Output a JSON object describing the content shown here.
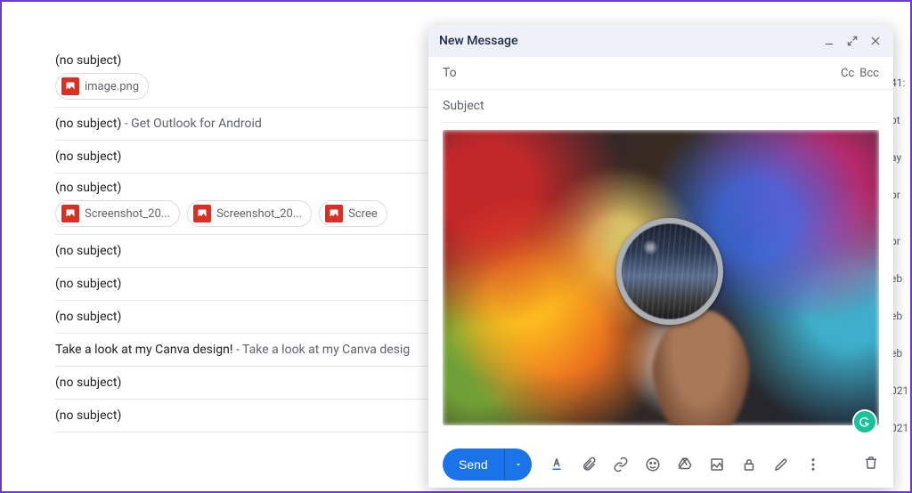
{
  "emails": [
    {
      "subject": "(no subject)",
      "snippet": "",
      "chips": [
        "image.png"
      ]
    },
    {
      "subject": "(no subject)",
      "snippet": "Get Outlook for Android",
      "chips": []
    },
    {
      "subject": "(no subject)",
      "snippet": "",
      "chips": []
    },
    {
      "subject": "(no subject)",
      "snippet": "",
      "chips": [
        "Screenshot_20...",
        "Screenshot_20...",
        "Scree"
      ]
    },
    {
      "subject": "(no subject)",
      "snippet": "",
      "chips": []
    },
    {
      "subject": "(no subject)",
      "snippet": "",
      "chips": []
    },
    {
      "subject": "(no subject)",
      "snippet": "",
      "chips": []
    },
    {
      "subject": "Take a look at my Canva design!",
      "snippet": "Take a look at my Canva desig",
      "chips": []
    },
    {
      "subject": "(no subject)",
      "snippet": "",
      "chips": []
    },
    {
      "subject": "(no subject)",
      "snippet": "",
      "chips": []
    }
  ],
  "right_tags": [
    "41:",
    "",
    "pt",
    "",
    "ay",
    "",
    "pr",
    "",
    "",
    "pr",
    "",
    "eb",
    "",
    "eb",
    "",
    "eb",
    "",
    "021",
    "",
    "021"
  ],
  "compose": {
    "title": "New Message",
    "to_label": "To",
    "cc": "Cc",
    "bcc": "Bcc",
    "subject_placeholder": "Subject",
    "send_label": "Send"
  }
}
